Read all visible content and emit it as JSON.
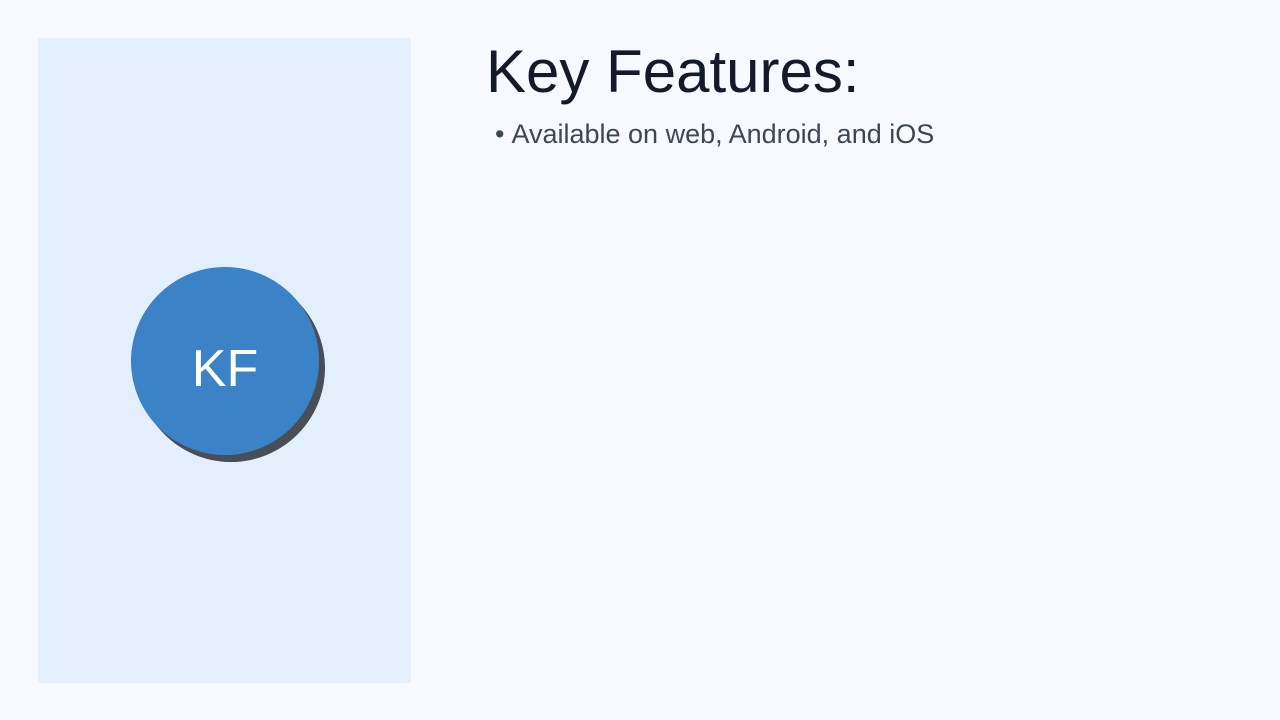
{
  "slide": {
    "avatar_initials": "KF",
    "title": "Key Features:",
    "features": [
      {
        "bullet": "•",
        "text": "Available on web, Android, and iOS"
      }
    ]
  },
  "colors": {
    "background": "#f8f9fe",
    "panel": "#e3effd",
    "avatar_fill": "#3b82c7",
    "avatar_shadow": "#4a4f57",
    "title_text": "#141a29",
    "body_text": "#3c4656"
  }
}
